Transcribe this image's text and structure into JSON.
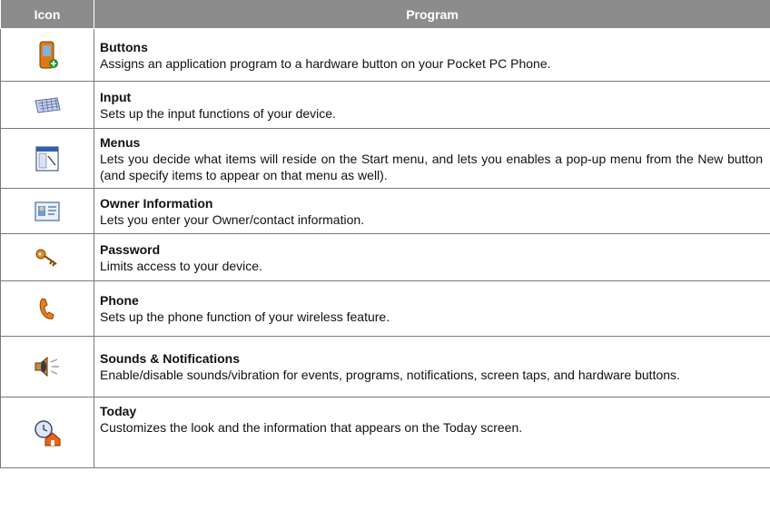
{
  "header": {
    "icon_col": "Icon",
    "program_col": "Program"
  },
  "rows": [
    {
      "icon": "buttons-icon",
      "name": "Buttons",
      "desc": "Assigns an application program to a hardware button on your Pocket PC Phone."
    },
    {
      "icon": "keyboard-icon",
      "name": "Input",
      "desc": "Sets up the input functions of your device."
    },
    {
      "icon": "menu-window-icon",
      "name": "Menus",
      "desc": "Lets you decide what items will reside on the Start menu, and lets you enables a pop-up menu from the New button (and specify items to appear on that menu as well)."
    },
    {
      "icon": "owner-card-icon",
      "name": "Owner Information",
      "desc": "Lets you enter your Owner/contact information."
    },
    {
      "icon": "keys-icon",
      "name": "Password",
      "desc": "Limits access to your device."
    },
    {
      "icon": "phone-handset-icon",
      "name": "Phone",
      "desc": "Sets up the phone function of your wireless feature."
    },
    {
      "icon": "speaker-icon",
      "name": "Sounds & Notifications",
      "desc": "Enable/disable sounds/vibration for events, programs, notifications, screen taps, and hardware buttons."
    },
    {
      "icon": "today-clock-home-icon",
      "name": "Today",
      "desc": "Customizes the look and the information that appears on the Today screen."
    }
  ]
}
